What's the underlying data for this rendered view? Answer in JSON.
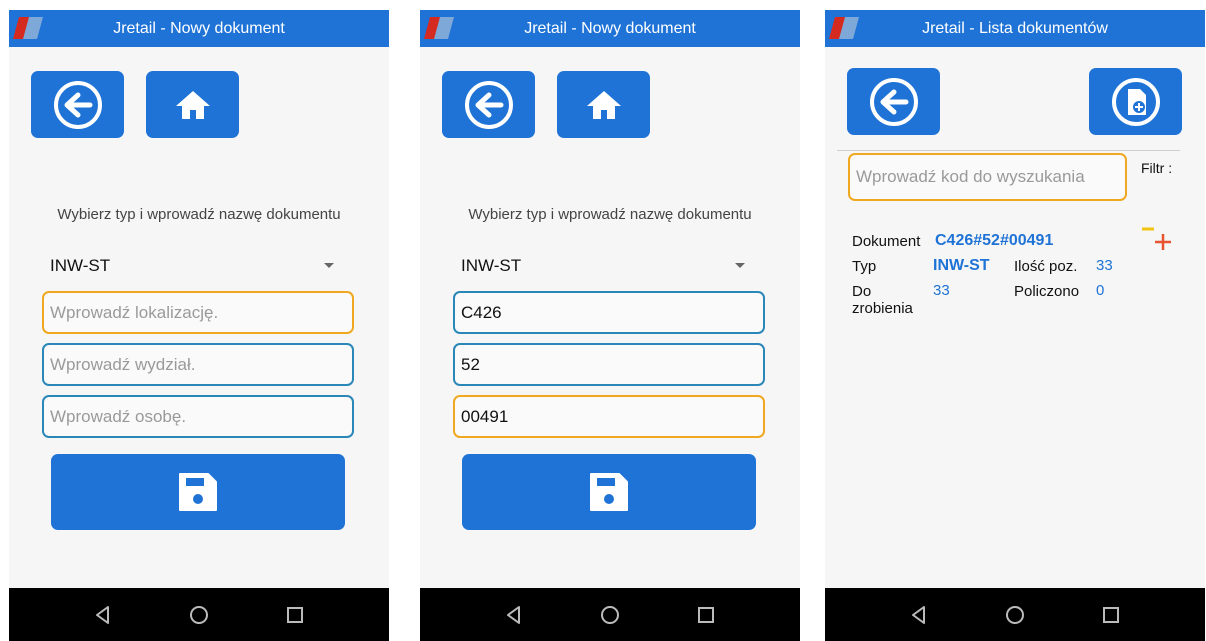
{
  "colors": {
    "primary": "#1f73d6",
    "focus_border": "#f1a821",
    "field_border": "#2a87b8",
    "value_text": "#1f73d6"
  },
  "screens": [
    {
      "title": "Jretail - Nowy dokument",
      "back_icon": "arrow-left-circle-icon",
      "home_icon": "home-icon",
      "instruction": "Wybierz typ i wprowadź nazwę dokumentu",
      "doc_type": "INW-ST",
      "fields": [
        {
          "value": "",
          "placeholder": "Wprowadź lokalizację."
        },
        {
          "value": "",
          "placeholder": "Wprowadź wydział."
        },
        {
          "value": "",
          "placeholder": "Wprowadź osobę."
        }
      ],
      "save_icon": "floppy-disk-icon"
    },
    {
      "title": "Jretail - Nowy dokument",
      "instruction": "Wybierz typ i wprowadź nazwę dokumentu",
      "doc_type": "INW-ST",
      "fields": [
        {
          "value": "C426",
          "placeholder": ""
        },
        {
          "value": "52",
          "placeholder": ""
        },
        {
          "value": "00491",
          "placeholder": ""
        }
      ]
    },
    {
      "title": "Jretail - Lista dokumentów",
      "back_icon": "arrow-left-circle-icon",
      "new_doc_icon": "file-plus-icon",
      "search_placeholder": "Wprowadź kod do wyszukania",
      "filter_label": "Filtr :",
      "document": {
        "label": "Dokument",
        "code": "C426#52#00491",
        "type_label": "Typ",
        "type_value": "INW-ST",
        "items_label": "Ilość poz.",
        "items_value": "33",
        "todo_label_1": "Do",
        "todo_label_2": "zrobienia",
        "todo_value": "33",
        "counted_label": "Policzono",
        "counted_value": "0"
      },
      "expand_icon": "minus-plus-icon"
    }
  ],
  "nav_icons": [
    "back-triangle-icon",
    "home-circle-icon",
    "recents-square-icon"
  ]
}
